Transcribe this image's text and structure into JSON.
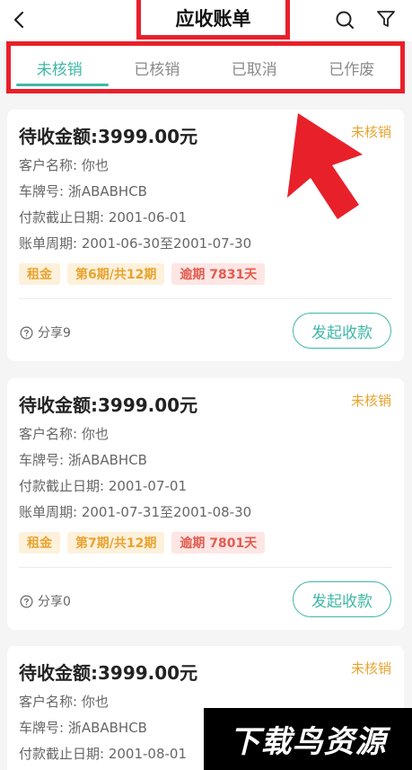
{
  "header": {
    "title": "应收账单",
    "back_icon": "chevron-left-icon",
    "search_icon": "search-icon",
    "filter_icon": "filter-icon"
  },
  "tabs": [
    {
      "label": "未核销",
      "active": true
    },
    {
      "label": "已核销",
      "active": false
    },
    {
      "label": "已取消",
      "active": false
    },
    {
      "label": "已作废",
      "active": false
    }
  ],
  "colors": {
    "accent": "#3fb7a7",
    "status_pending": "#e9a32f",
    "overdue": "#e35c4f",
    "highlight": "#e8202a"
  },
  "bills": [
    {
      "amount": "待收金额:3999.00元",
      "status": "未核销",
      "customer": "客户名称: 你也",
      "plate": "车牌号: 浙ABABHCB",
      "due_date": "付款截止日期: 2001-06-01",
      "bill_period": "账单周期: 2001-06-30至2001-07-30",
      "tag_type": "租金",
      "tag_period": "第6期/共12期",
      "tag_overdue": "逾期 7831天",
      "share": "分享9",
      "action": "发起收款"
    },
    {
      "amount": "待收金额:3999.00元",
      "status": "未核销",
      "customer": "客户名称: 你也",
      "plate": "车牌号: 浙ABABHCB",
      "due_date": "付款截止日期: 2001-07-01",
      "bill_period": "账单周期: 2001-07-31至2001-08-30",
      "tag_type": "租金",
      "tag_period": "第7期/共12期",
      "tag_overdue": "逾期 7801天",
      "share": "分享0",
      "action": "发起收款"
    },
    {
      "amount": "待收金额:3999.00元",
      "status": "未核销",
      "customer": "客户名称: 你也",
      "plate": "车牌号: 浙ABABHCB",
      "due_date": "付款截止日期: 2001-08-01"
    }
  ],
  "watermark": "下载鸟资源"
}
